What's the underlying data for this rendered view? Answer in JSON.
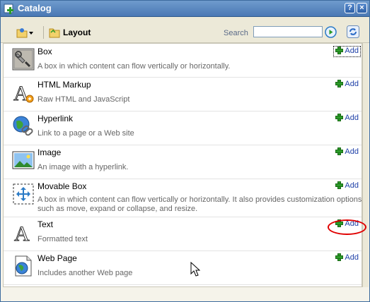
{
  "window": {
    "title": "Catalog"
  },
  "title_buttons": {
    "help": "?",
    "close": "×"
  },
  "toolbar": {
    "layout_label": "Layout"
  },
  "search": {
    "label": "Search",
    "value": ""
  },
  "items": [
    {
      "name": "Box",
      "description": "A box in which content can flow vertically or horizontally.",
      "add_label": "Add",
      "icon": "box-icon"
    },
    {
      "name": "HTML Markup",
      "description": "Raw HTML and JavaScript",
      "add_label": "Add",
      "icon": "html-markup-icon"
    },
    {
      "name": "Hyperlink",
      "description": "Link to a page or a Web site",
      "add_label": "Add",
      "icon": "hyperlink-icon"
    },
    {
      "name": "Image",
      "description": "An image with a hyperlink.",
      "add_label": "Add",
      "icon": "image-icon"
    },
    {
      "name": "Movable Box",
      "description": "A box in which content can flow vertically or horizontally. It also provides customization options such as move, expand or collapse, and resize.",
      "add_label": "Add",
      "icon": "movable-box-icon"
    },
    {
      "name": "Text",
      "description": "Formatted text",
      "add_label": "Add",
      "icon": "text-icon"
    },
    {
      "name": "Web Page",
      "description": "Includes another Web page",
      "add_label": "Add",
      "icon": "web-page-icon"
    }
  ],
  "colors": {
    "link": "#1d3fa7",
    "title_bar": "#4a78b4",
    "highlight": "#e00000"
  }
}
